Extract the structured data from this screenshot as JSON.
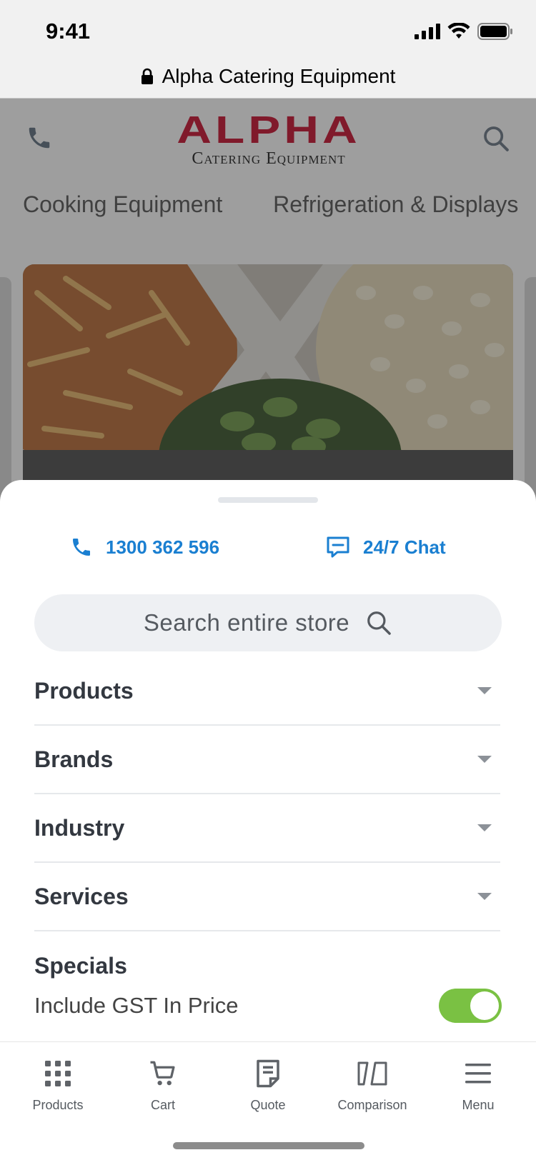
{
  "status_bar": {
    "time": "9:41"
  },
  "url_bar": {
    "title": "Alpha Catering Equipment",
    "lock_icon": "lock-icon"
  },
  "site": {
    "logo_main": "ALPHA",
    "logo_sub": "Catering Equipment",
    "categories": [
      "Cooking Equipment",
      "Refrigeration & Displays"
    ],
    "phone_icon": "phone-icon",
    "search_icon": "search-icon"
  },
  "sheet": {
    "phone_number": "1300 362 596",
    "chat_label": "24/7 Chat",
    "search_placeholder": "Search entire store",
    "menu_items": [
      {
        "label": "Products",
        "has_caret": true
      },
      {
        "label": "Brands",
        "has_caret": true
      },
      {
        "label": "Industry",
        "has_caret": true
      },
      {
        "label": "Services",
        "has_caret": true
      },
      {
        "label": "Specials",
        "has_caret": false
      }
    ],
    "gst_label": "Include GST In Price",
    "gst_enabled": true
  },
  "tab_bar": {
    "tabs": [
      {
        "label": "Products",
        "icon": "grid-icon"
      },
      {
        "label": "Cart",
        "icon": "cart-icon"
      },
      {
        "label": "Quote",
        "icon": "quote-icon"
      },
      {
        "label": "Comparison",
        "icon": "comparison-icon"
      },
      {
        "label": "Menu",
        "icon": "menu-icon"
      }
    ]
  },
  "colors": {
    "accent_blue": "#1a7fd1",
    "brand_red": "#c8102e",
    "toggle_green": "#7ac143"
  }
}
